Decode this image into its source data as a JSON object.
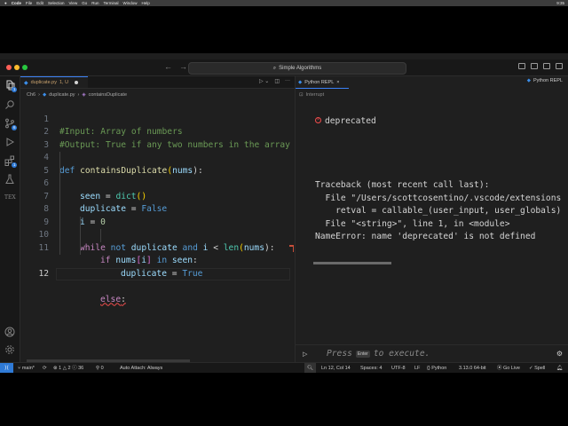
{
  "menubar": {
    "app": "Code",
    "items": [
      "File",
      "Edit",
      "Selection",
      "View",
      "Go",
      "Run",
      "Terminal",
      "Window",
      "Help"
    ],
    "clock": "9:35"
  },
  "titlebar": {
    "search_text": "Simple Algorithms",
    "nav_back": "←",
    "nav_forward": "→"
  },
  "activity_badges": {
    "source_control": "6",
    "extensions": "1"
  },
  "editor": {
    "tab_label": "duplicate.py",
    "tab_status": "1, U",
    "breadcrumb": [
      "Ch6",
      "duplicate.py",
      "containsDuplicate"
    ],
    "active_line": "12",
    "line_numbers": [
      "1",
      "2",
      "3",
      "4",
      "5",
      "6",
      "7",
      "8",
      "9",
      "10",
      "11",
      "12"
    ],
    "lines": {
      "l1": "#Input: Array of numbers",
      "l2": "#Output: True if any two numbers in the array",
      "l4_def": "def",
      "l4_name": "containsDuplicate",
      "l4_p1": "(",
      "l4_arg": "nums",
      "l4_p2": "):",
      "l5_var": "seen",
      "l5_eq": " = ",
      "l5_fn": "dict",
      "l5_paren": "()",
      "l6_var": "duplicate",
      "l6_eq": " = ",
      "l6_val": "False",
      "l7_var": "i",
      "l7_eq": " = ",
      "l7_val": "0",
      "l9_while": "while",
      "l9_not": " not ",
      "l9_dup": "duplicate",
      "l9_and": " and ",
      "l9_i": "i",
      "l9_lt": " < ",
      "l9_len": "len",
      "l9_p1": "(",
      "l9_nums": "nums",
      "l9_p2": "):",
      "l10_if": "if",
      "l10_nums": "nums",
      "l10_b1": "[",
      "l10_i": "i",
      "l10_b2": "]",
      "l10_in": " in ",
      "l10_seen": "seen",
      "l10_colon": ":",
      "l11_dup": "duplicate",
      "l11_eq": " = ",
      "l11_val": "True",
      "l12_else": "else",
      "l12_colon": ":"
    }
  },
  "repl": {
    "tab_label": "Python REPL",
    "tab_right_label": "Python REPL",
    "interrupt_label": "Interrupt",
    "cell_label": "deprecated",
    "output": [
      "Traceback (most recent call last):",
      "  File \"/Users/scottcosentino/.vscode/extensions",
      "    retval = callable_(user_input, user_globals)",
      "  File \"<string>\", line 1, in <module>",
      "NameError: name 'deprecated' is not defined"
    ],
    "input_hint_prefix": "Press",
    "input_hint_key": "Enter",
    "input_hint_suffix": "to execute."
  },
  "statusbar": {
    "branch": "main*",
    "errors": "1",
    "warnings": "2",
    "infos": "36",
    "ports": "0",
    "auto_attach": "Auto Attach: Always",
    "position": "Ln 12, Col 14",
    "spaces": "Spaces: 4",
    "encoding": "UTF-8",
    "eol": "LF",
    "language": "Python",
    "interpreter": "3.13.0 64-bit",
    "go_live": "Go Live",
    "spell": "Spell"
  },
  "colors": {
    "accent": "#2f7ad6",
    "error": "#f14c4c",
    "background": "#1f1f1f"
  }
}
